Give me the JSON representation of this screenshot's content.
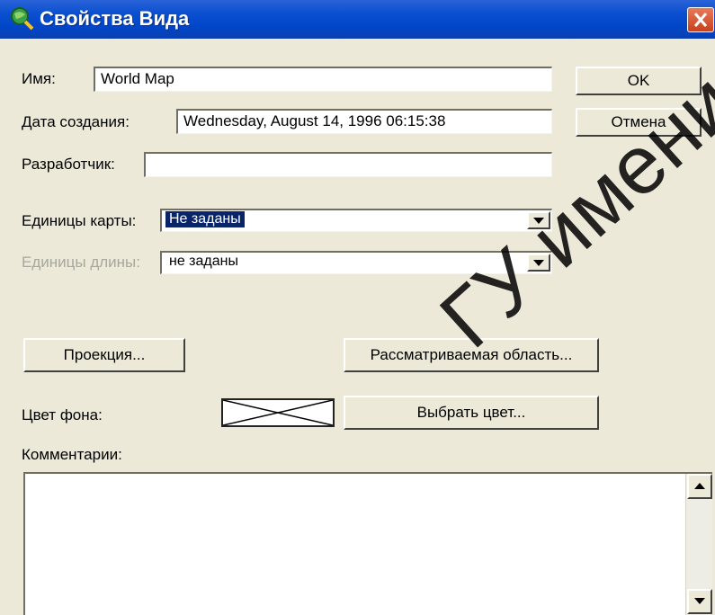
{
  "window": {
    "title": "Свойства Вида",
    "title_icon": "globe-magnifier-icon",
    "close_icon": "close-icon"
  },
  "fields": {
    "name": {
      "label": "Имя:",
      "value": "World Map"
    },
    "created": {
      "label": "Дата создания:",
      "value": "Wednesday, August 14, 1996 06:15:38"
    },
    "developer": {
      "label": "Разработчик:",
      "value": ""
    }
  },
  "map_units": {
    "label": "Единицы карты:",
    "value": "Не заданы"
  },
  "length_units": {
    "label": "Единицы длины:",
    "value": "не заданы"
  },
  "buttons": {
    "ok": "OK",
    "cancel": "Отмена",
    "projection": "Проекция...",
    "view_area": "Рассматриваемая область...",
    "choose_color": "Выбрать цвет..."
  },
  "background_color": {
    "label": "Цвет фона:",
    "value": "none"
  },
  "comments": {
    "label": "Комментарии:",
    "value": ""
  },
  "watermark": "ГУ имени А.А."
}
